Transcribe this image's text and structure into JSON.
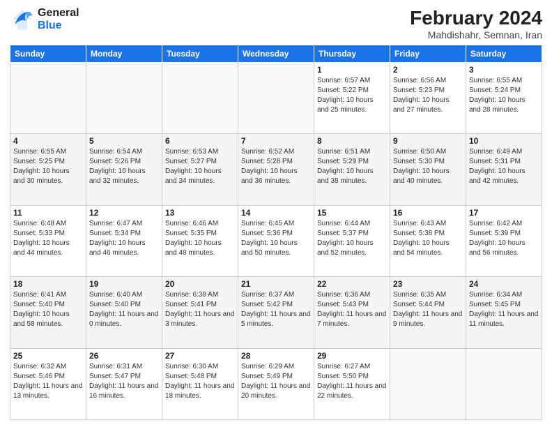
{
  "logo": {
    "line1": "General",
    "line2": "Blue"
  },
  "title": "February 2024",
  "subtitle": "Mahdishahr, Semnan, Iran",
  "weekdays": [
    "Sunday",
    "Monday",
    "Tuesday",
    "Wednesday",
    "Thursday",
    "Friday",
    "Saturday"
  ],
  "weeks": [
    [
      {
        "day": "",
        "info": ""
      },
      {
        "day": "",
        "info": ""
      },
      {
        "day": "",
        "info": ""
      },
      {
        "day": "",
        "info": ""
      },
      {
        "day": "1",
        "info": "Sunrise: 6:57 AM\nSunset: 5:22 PM\nDaylight: 10 hours and 25 minutes."
      },
      {
        "day": "2",
        "info": "Sunrise: 6:56 AM\nSunset: 5:23 PM\nDaylight: 10 hours and 27 minutes."
      },
      {
        "day": "3",
        "info": "Sunrise: 6:55 AM\nSunset: 5:24 PM\nDaylight: 10 hours and 28 minutes."
      }
    ],
    [
      {
        "day": "4",
        "info": "Sunrise: 6:55 AM\nSunset: 5:25 PM\nDaylight: 10 hours and 30 minutes."
      },
      {
        "day": "5",
        "info": "Sunrise: 6:54 AM\nSunset: 5:26 PM\nDaylight: 10 hours and 32 minutes."
      },
      {
        "day": "6",
        "info": "Sunrise: 6:53 AM\nSunset: 5:27 PM\nDaylight: 10 hours and 34 minutes."
      },
      {
        "day": "7",
        "info": "Sunrise: 6:52 AM\nSunset: 5:28 PM\nDaylight: 10 hours and 36 minutes."
      },
      {
        "day": "8",
        "info": "Sunrise: 6:51 AM\nSunset: 5:29 PM\nDaylight: 10 hours and 38 minutes."
      },
      {
        "day": "9",
        "info": "Sunrise: 6:50 AM\nSunset: 5:30 PM\nDaylight: 10 hours and 40 minutes."
      },
      {
        "day": "10",
        "info": "Sunrise: 6:49 AM\nSunset: 5:31 PM\nDaylight: 10 hours and 42 minutes."
      }
    ],
    [
      {
        "day": "11",
        "info": "Sunrise: 6:48 AM\nSunset: 5:33 PM\nDaylight: 10 hours and 44 minutes."
      },
      {
        "day": "12",
        "info": "Sunrise: 6:47 AM\nSunset: 5:34 PM\nDaylight: 10 hours and 46 minutes."
      },
      {
        "day": "13",
        "info": "Sunrise: 6:46 AM\nSunset: 5:35 PM\nDaylight: 10 hours and 48 minutes."
      },
      {
        "day": "14",
        "info": "Sunrise: 6:45 AM\nSunset: 5:36 PM\nDaylight: 10 hours and 50 minutes."
      },
      {
        "day": "15",
        "info": "Sunrise: 6:44 AM\nSunset: 5:37 PM\nDaylight: 10 hours and 52 minutes."
      },
      {
        "day": "16",
        "info": "Sunrise: 6:43 AM\nSunset: 5:38 PM\nDaylight: 10 hours and 54 minutes."
      },
      {
        "day": "17",
        "info": "Sunrise: 6:42 AM\nSunset: 5:39 PM\nDaylight: 10 hours and 56 minutes."
      }
    ],
    [
      {
        "day": "18",
        "info": "Sunrise: 6:41 AM\nSunset: 5:40 PM\nDaylight: 10 hours and 58 minutes."
      },
      {
        "day": "19",
        "info": "Sunrise: 6:40 AM\nSunset: 5:40 PM\nDaylight: 11 hours and 0 minutes."
      },
      {
        "day": "20",
        "info": "Sunrise: 6:38 AM\nSunset: 5:41 PM\nDaylight: 11 hours and 3 minutes."
      },
      {
        "day": "21",
        "info": "Sunrise: 6:37 AM\nSunset: 5:42 PM\nDaylight: 11 hours and 5 minutes."
      },
      {
        "day": "22",
        "info": "Sunrise: 6:36 AM\nSunset: 5:43 PM\nDaylight: 11 hours and 7 minutes."
      },
      {
        "day": "23",
        "info": "Sunrise: 6:35 AM\nSunset: 5:44 PM\nDaylight: 11 hours and 9 minutes."
      },
      {
        "day": "24",
        "info": "Sunrise: 6:34 AM\nSunset: 5:45 PM\nDaylight: 11 hours and 11 minutes."
      }
    ],
    [
      {
        "day": "25",
        "info": "Sunrise: 6:32 AM\nSunset: 5:46 PM\nDaylight: 11 hours and 13 minutes."
      },
      {
        "day": "26",
        "info": "Sunrise: 6:31 AM\nSunset: 5:47 PM\nDaylight: 11 hours and 16 minutes."
      },
      {
        "day": "27",
        "info": "Sunrise: 6:30 AM\nSunset: 5:48 PM\nDaylight: 11 hours and 18 minutes."
      },
      {
        "day": "28",
        "info": "Sunrise: 6:29 AM\nSunset: 5:49 PM\nDaylight: 11 hours and 20 minutes."
      },
      {
        "day": "29",
        "info": "Sunrise: 6:27 AM\nSunset: 5:50 PM\nDaylight: 11 hours and 22 minutes."
      },
      {
        "day": "",
        "info": ""
      },
      {
        "day": "",
        "info": ""
      }
    ]
  ]
}
